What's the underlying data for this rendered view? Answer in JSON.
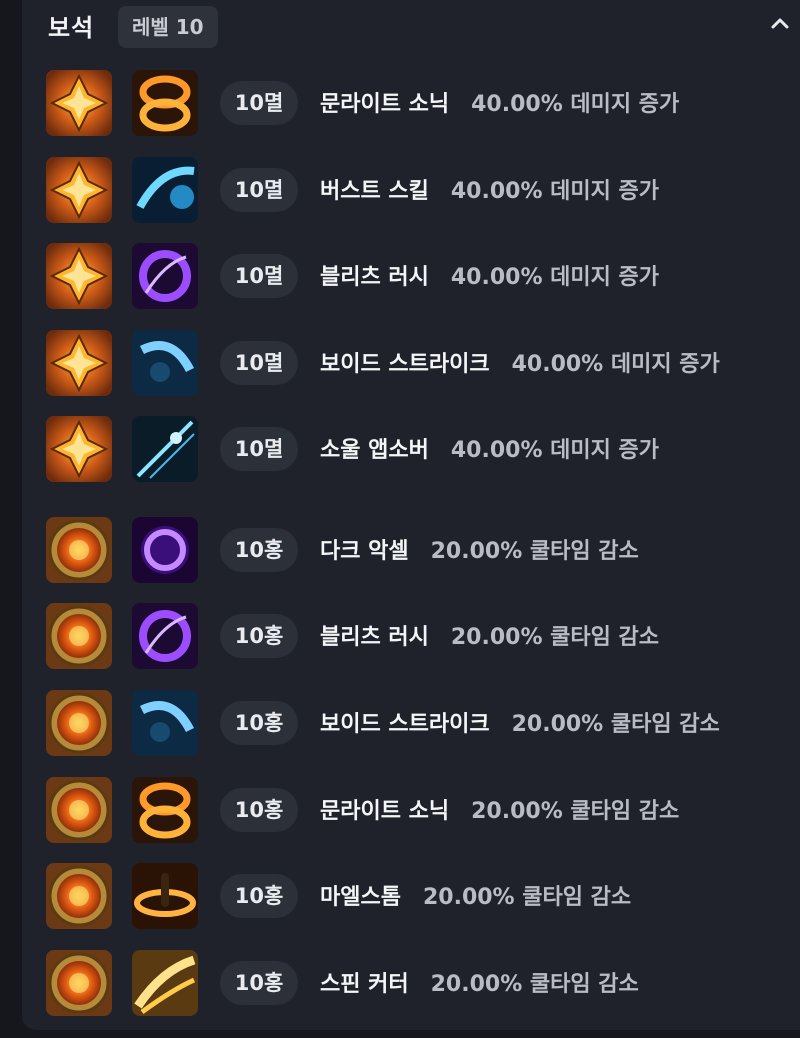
{
  "header": {
    "title": "보석",
    "level_badge": "레벨 10"
  },
  "gems": [
    {
      "gem_type": "멸",
      "gem_icon": "fire-gem-icon",
      "skill_icon": "moonlight-sonic-skill-icon",
      "level": "10멸",
      "skill": "문라이트 소닉",
      "effect": "40.00% 데미지 증가"
    },
    {
      "gem_type": "멸",
      "gem_icon": "fire-gem-icon",
      "skill_icon": "burst-skill-icon",
      "level": "10멸",
      "skill": "버스트 스킬",
      "effect": "40.00% 데미지 증가"
    },
    {
      "gem_type": "멸",
      "gem_icon": "fire-gem-icon",
      "skill_icon": "blitz-rush-skill-icon",
      "level": "10멸",
      "skill": "블리츠 러시",
      "effect": "40.00% 데미지 증가"
    },
    {
      "gem_type": "멸",
      "gem_icon": "fire-gem-icon",
      "skill_icon": "void-strike-skill-icon",
      "level": "10멸",
      "skill": "보이드 스트라이크",
      "effect": "40.00% 데미지 증가"
    },
    {
      "gem_type": "멸",
      "gem_icon": "fire-gem-icon",
      "skill_icon": "soul-absorber-skill-icon",
      "level": "10멸",
      "skill": "소울 앱소버",
      "effect": "40.00% 데미지 증가"
    },
    {
      "gem_type": "홍",
      "gem_icon": "red-gem-icon",
      "skill_icon": "dark-axel-skill-icon",
      "level": "10홍",
      "skill": "다크 악셀",
      "effect": "20.00% 쿨타임 감소"
    },
    {
      "gem_type": "홍",
      "gem_icon": "red-gem-icon",
      "skill_icon": "blitz-rush-skill-icon",
      "level": "10홍",
      "skill": "블리츠 러시",
      "effect": "20.00% 쿨타임 감소"
    },
    {
      "gem_type": "홍",
      "gem_icon": "red-gem-icon",
      "skill_icon": "void-strike-skill-icon",
      "level": "10홍",
      "skill": "보이드 스트라이크",
      "effect": "20.00% 쿨타임 감소"
    },
    {
      "gem_type": "홍",
      "gem_icon": "red-gem-icon",
      "skill_icon": "moonlight-sonic-skill-icon",
      "level": "10홍",
      "skill": "문라이트 소닉",
      "effect": "20.00% 쿨타임 감소"
    },
    {
      "gem_type": "홍",
      "gem_icon": "red-gem-icon",
      "skill_icon": "maelstrom-skill-icon",
      "level": "10홍",
      "skill": "마엘스톰",
      "effect": "20.00% 쿨타임 감소"
    },
    {
      "gem_type": "홍",
      "gem_icon": "red-gem-icon",
      "skill_icon": "spin-cutter-skill-icon",
      "level": "10홍",
      "skill": "스핀 커터",
      "effect": "20.00% 쿨타임 감소"
    }
  ]
}
